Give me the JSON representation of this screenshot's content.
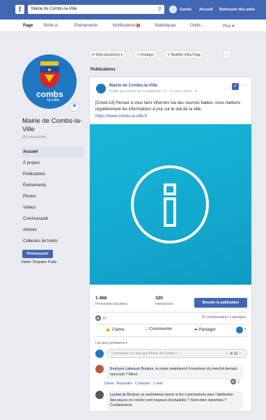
{
  "topbar": {
    "logo": "f",
    "search_value": "Mairie de Combs-la-Ville",
    "user_name": "Carole",
    "home_label": "Accueil",
    "find_friends_label": "Retrouver des amis",
    "bg_color": "#4267b2"
  },
  "page_nav": {
    "items": [
      {
        "label": "Page"
      },
      {
        "label": "Boîte d..."
      },
      {
        "label": "Événements"
      },
      {
        "label": "Notifications",
        "badge": "2"
      },
      {
        "label": "Statistiques"
      },
      {
        "label": "Outils ..."
      },
      {
        "label": "Plus ▾"
      }
    ]
  },
  "profile": {
    "logo_text": "combs",
    "logo_sub": "la-ville",
    "page_name": "Mairie de Combs-la-Ville",
    "handle": "@CombslaVille",
    "brand_color": "#1f77c2"
  },
  "left_nav": {
    "items": [
      {
        "label": "Accueil"
      },
      {
        "label": "À propos"
      },
      {
        "label": "Publications"
      },
      {
        "label": "Événements"
      },
      {
        "label": "Photos"
      },
      {
        "label": "Vidéos"
      },
      {
        "label": "Communauté"
      },
      {
        "label": "Articles"
      },
      {
        "label": "Collectes de fonds"
      }
    ],
    "promote_label": "Promouvoir",
    "ads_label": "Visiter l'Espace Pubs"
  },
  "action_bar": {
    "subscribed_label": "Déjà abonné(e) ▾",
    "share_label": "Partager",
    "edit_label": "Modifier infos Page",
    "more_label": "···"
  },
  "publications_header": "Publications",
  "post": {
    "author": "Mairie de Combs-la-Ville",
    "meta": "Publié par Antoine de CombslaVille (?) · 17 mars, 08:31 · ",
    "text": "[Covid-19] Pensez à vous tenir informés via des sources fiables, nous mettons régulièrement les informations à jour sur le site de la ville.",
    "link": "https://www.combs-la-ville.fr",
    "image_color": "#19b6d6",
    "reached_num": "1 468",
    "reached_label": "Personnes touchées",
    "interactions_num": "320",
    "interactions_label": "Interactions",
    "boost_label": "Booster la publication",
    "likes": "13",
    "counts": "23 commentaires  3 partages",
    "like_btn": "J'aime",
    "comment_btn": "Commenter",
    "share_btn": "Partager",
    "relevant_label": "Les plus pertinents ▾",
    "comment_placeholder": "Commenter en tant que Mairie de Combs-l..."
  },
  "replies": [
    {
      "name": "Evelyne Labossé",
      "text": " Bonjour, le maire maintient-il l'ouverture du marché demain mercredi ? Merci",
      "actions": "J'aime · Répondre · Contacter · 2 sem",
      "react": "1"
    },
    {
      "name": "Lysian Ip",
      "text": " Bonjour, je souhaiterai savoir si les commissions pour l'attribution des places en crèche sont toujours d'actualités ? Sont-elles reportées ? Cordialement."
    }
  ]
}
